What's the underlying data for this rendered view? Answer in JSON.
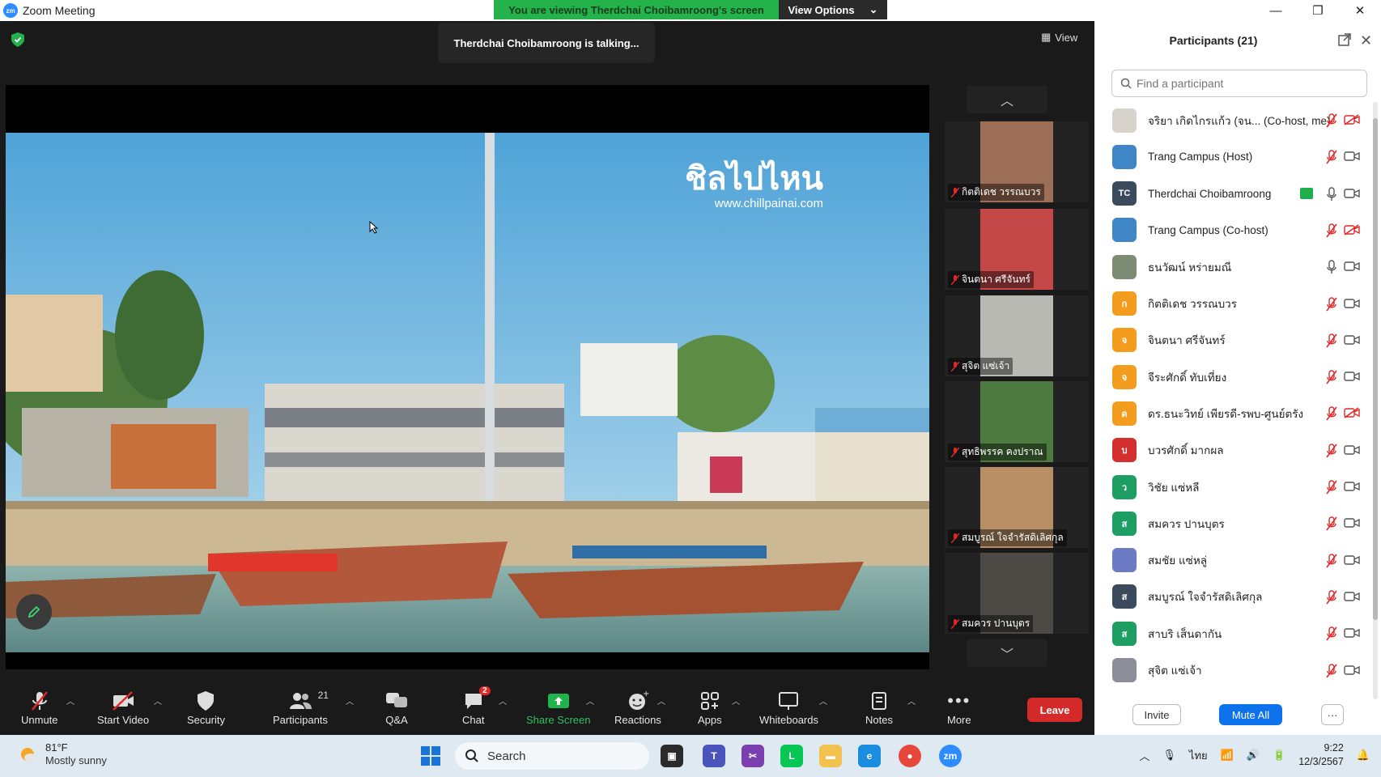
{
  "window": {
    "title": "Zoom Meeting",
    "app_icon_text": "zm",
    "share_banner": "You are viewing Therdchai Choibamroong's screen",
    "view_options_label": "View Options"
  },
  "meeting": {
    "talking_text": "Therdchai Choibamroong is talking...",
    "view_label": "View",
    "shared_logo_text": "ชิลไปไหน",
    "shared_logo_url": "www.chillpainai.com"
  },
  "gallery": [
    {
      "name": "กิตติเดช วรรณบวร",
      "bg": "#9d6f56"
    },
    {
      "name": "จินตนา ศรีจันทร์",
      "bg": "#c44848"
    },
    {
      "name": "สุจิต แซ่เจ้า",
      "bg": "#b9b9b4"
    },
    {
      "name": "สุทธิพรรค คงปราณ",
      "bg": "#4c7a3f"
    },
    {
      "name": "สมบูรณ์ ใจจำรัสดิเลิศกุล",
      "bg": "#b88f64"
    },
    {
      "name": "สมควร ปานบุตร",
      "bg": "#4d4a45"
    }
  ],
  "toolbar": {
    "unmute": "Unmute",
    "start_video": "Start Video",
    "security": "Security",
    "participants": "Participants",
    "participants_count": "21",
    "qa": "Q&A",
    "chat": "Chat",
    "chat_badge": "2",
    "share_screen": "Share Screen",
    "reactions": "Reactions",
    "apps": "Apps",
    "whiteboards": "Whiteboards",
    "notes": "Notes",
    "more": "More",
    "leave": "Leave"
  },
  "panel": {
    "title": "Participants (21)",
    "search_placeholder": "Find a participant",
    "invite": "Invite",
    "mute_all": "Mute All",
    "more": "···",
    "participants": [
      {
        "name": "จริยา เกิดไกรแก้ว (จน... (Co-host, me)",
        "initial": "",
        "color": "#d8d2cc",
        "mic": "muted",
        "video": "off",
        "sharing": false
      },
      {
        "name": "Trang Campus (Host)",
        "initial": "",
        "color": "#3f86c7",
        "mic": "muted",
        "video": "on",
        "sharing": false
      },
      {
        "name": "Therdchai Choibamroong",
        "initial": "TC",
        "color": "#3b4a5c",
        "mic": "active",
        "video": "on",
        "sharing": true
      },
      {
        "name": "Trang Campus (Co-host)",
        "initial": "",
        "color": "#3f86c7",
        "mic": "muted",
        "video": "off",
        "sharing": false
      },
      {
        "name": "ธนวัฒน์ หร่ายมณี",
        "initial": "",
        "color": "#7d8b74",
        "mic": "active",
        "video": "on",
        "sharing": false
      },
      {
        "name": "กิตติเดช วรรณบวร",
        "initial": "ก",
        "color": "#f39c1d",
        "mic": "muted",
        "video": "on",
        "sharing": false
      },
      {
        "name": "จินตนา ศรีจันทร์",
        "initial": "จ",
        "color": "#f39c1d",
        "mic": "muted",
        "video": "on",
        "sharing": false
      },
      {
        "name": "จีระศักดิ์ ทับเที่ยง",
        "initial": "จ",
        "color": "#f39c1d",
        "mic": "muted",
        "video": "on",
        "sharing": false
      },
      {
        "name": "ดร.ธนะวิทย์ เพียรดี-รพบ-ศูนย์ตรัง",
        "initial": "ด",
        "color": "#f39c1d",
        "mic": "muted",
        "video": "off",
        "sharing": false
      },
      {
        "name": "บวรศักดิ์ มากผล",
        "initial": "บ",
        "color": "#d32f2f",
        "mic": "muted",
        "video": "on",
        "sharing": false
      },
      {
        "name": "วิชัย แซ่หลี",
        "initial": "ว",
        "color": "#1e9e63",
        "mic": "muted",
        "video": "on",
        "sharing": false
      },
      {
        "name": "สมควร ปานบุตร",
        "initial": "ส",
        "color": "#1e9e63",
        "mic": "muted",
        "video": "on",
        "sharing": false
      },
      {
        "name": "สมชัย แซ่หลู่",
        "initial": "",
        "color": "#6d7bc4",
        "mic": "muted",
        "video": "on",
        "sharing": false
      },
      {
        "name": "สมบูรณ์ ใจจำรัสดิเลิศกุล",
        "initial": "ส",
        "color": "#3b4a5c",
        "mic": "muted",
        "video": "on",
        "sharing": false
      },
      {
        "name": "สาบริ เส็นดากัน",
        "initial": "ส",
        "color": "#1e9e63",
        "mic": "muted",
        "video": "on",
        "sharing": false
      },
      {
        "name": "สุจิต แซ่เจ้า",
        "initial": "",
        "color": "#8c8f99",
        "mic": "muted",
        "video": "on",
        "sharing": false
      }
    ]
  },
  "taskbar": {
    "temperature": "81°F",
    "condition": "Mostly sunny",
    "search_label": "Search",
    "language": "ไทย",
    "time": "9:22",
    "date": "12/3/2567"
  }
}
